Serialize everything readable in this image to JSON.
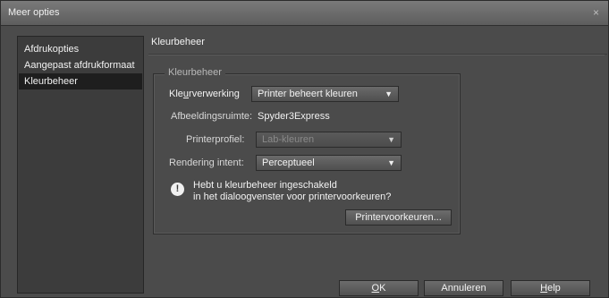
{
  "window": {
    "title": "Meer opties",
    "close_glyph": "×"
  },
  "sidebar": {
    "items": [
      {
        "label": "Afdrukopties"
      },
      {
        "label": "Aangepast afdrukformaat"
      },
      {
        "label": "Kleurbeheer"
      }
    ]
  },
  "content": {
    "title": "Kleurbeheer",
    "group_legend": "Kleurbeheer",
    "color_handling": {
      "label_pre": "Kle",
      "label_accel": "u",
      "label_post": "rverwerking",
      "value": "Printer beheert kleuren"
    },
    "image_space": {
      "label": "Afbeeldingsruimte:",
      "value": "Spyder3Express"
    },
    "printer_profile": {
      "label": "Printerprofiel:",
      "value": "Lab-kleuren"
    },
    "rendering_intent": {
      "label": "Rendering intent:",
      "value": "Perceptueel"
    },
    "info": {
      "icon": "!",
      "line1": "Hebt u kleurbeheer ingeschakeld",
      "line2": "in het dialoogvenster voor printervoorkeuren?"
    },
    "printer_prefs_button": "Printervoorkeuren..."
  },
  "footer": {
    "ok": {
      "accel": "O",
      "rest": "K"
    },
    "cancel": "Annuleren",
    "help": {
      "accel": "H",
      "rest": "elp"
    }
  },
  "icons": {
    "dropdown_arrow": "▼"
  }
}
